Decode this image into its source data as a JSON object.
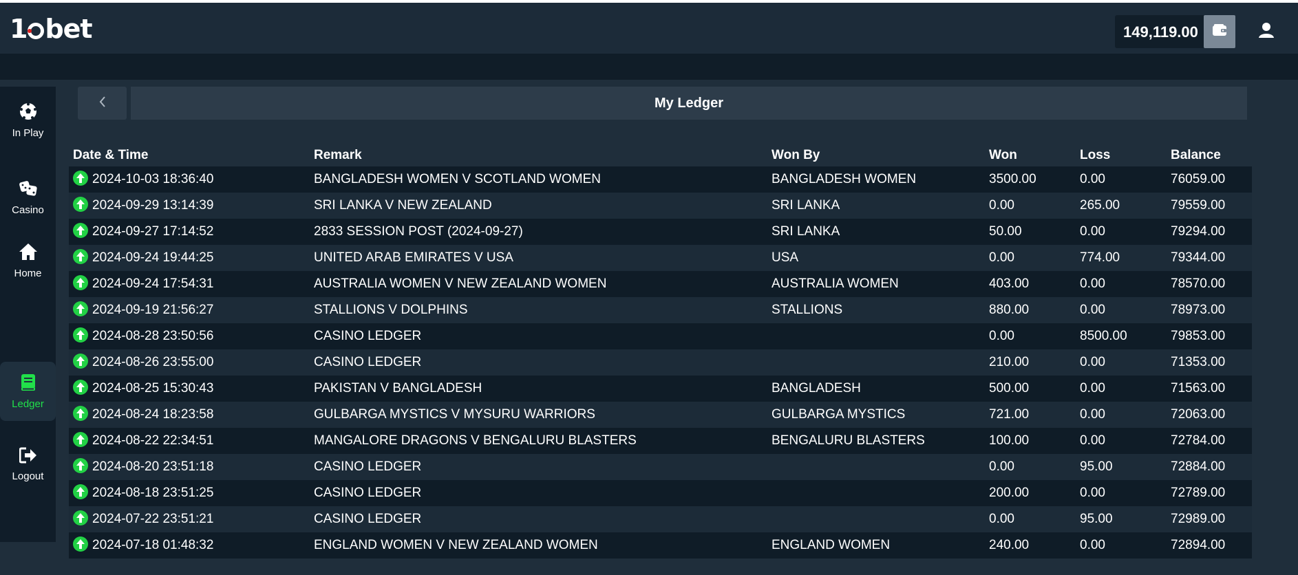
{
  "header": {
    "balance": "149,119.00"
  },
  "sidebar": {
    "items": [
      {
        "label": "In Play",
        "icon": "soccer-ball-icon"
      },
      {
        "label": "Casino",
        "icon": "dice-icon"
      },
      {
        "label": "Home",
        "icon": "home-icon"
      },
      {
        "label": "Ledger",
        "icon": "ledger-book-icon",
        "active": true
      },
      {
        "label": "Logout",
        "icon": "logout-icon"
      }
    ]
  },
  "page": {
    "title": "My Ledger"
  },
  "table": {
    "headers": [
      "Date & Time",
      "Remark",
      "Won By",
      "Won",
      "Loss",
      "Balance"
    ],
    "rows": [
      [
        "2024-10-03 18:36:40",
        "BANGLADESH WOMEN V SCOTLAND WOMEN",
        "BANGLADESH WOMEN",
        "3500.00",
        "0.00",
        "76059.00"
      ],
      [
        "2024-09-29 13:14:39",
        "SRI LANKA V NEW ZEALAND",
        "SRI LANKA",
        "0.00",
        "265.00",
        "79559.00"
      ],
      [
        "2024-09-27 17:14:52",
        "2833 SESSION POST (2024-09-27)",
        "SRI LANKA",
        "50.00",
        "0.00",
        "79294.00"
      ],
      [
        "2024-09-24 19:44:25",
        "UNITED ARAB EMIRATES V USA",
        "USA",
        "0.00",
        "774.00",
        "79344.00"
      ],
      [
        "2024-09-24 17:54:31",
        "AUSTRALIA WOMEN V NEW ZEALAND WOMEN",
        "AUSTRALIA WOMEN",
        "403.00",
        "0.00",
        "78570.00"
      ],
      [
        "2024-09-19 21:56:27",
        "STALLIONS V DOLPHINS",
        "STALLIONS",
        "880.00",
        "0.00",
        "78973.00"
      ],
      [
        "2024-08-28 23:50:56",
        "CASINO LEDGER",
        "",
        "0.00",
        "8500.00",
        "79853.00"
      ],
      [
        "2024-08-26 23:55:00",
        "CASINO LEDGER",
        "",
        "210.00",
        "0.00",
        "71353.00"
      ],
      [
        "2024-08-25 15:30:43",
        "PAKISTAN V BANGLADESH",
        "BANGLADESH",
        "500.00",
        "0.00",
        "71563.00"
      ],
      [
        "2024-08-24 18:23:58",
        "GULBARGA MYSTICS V MYSURU WARRIORS",
        "GULBARGA MYSTICS",
        "721.00",
        "0.00",
        "72063.00"
      ],
      [
        "2024-08-22 22:34:51",
        "MANGALORE DRAGONS V BENGALURU BLASTERS",
        "BENGALURU BLASTERS",
        "100.00",
        "0.00",
        "72784.00"
      ],
      [
        "2024-08-20 23:51:18",
        "CASINO LEDGER",
        "",
        "0.00",
        "95.00",
        "72884.00"
      ],
      [
        "2024-08-18 23:51:25",
        "CASINO LEDGER",
        "",
        "200.00",
        "0.00",
        "72789.00"
      ],
      [
        "2024-07-22 23:51:21",
        "CASINO LEDGER",
        "",
        "0.00",
        "95.00",
        "72989.00"
      ],
      [
        "2024-07-18 01:48:32",
        "ENGLAND WOMEN V NEW ZEALAND WOMEN",
        "ENGLAND WOMEN",
        "240.00",
        "0.00",
        "72894.00"
      ]
    ]
  },
  "colors": {
    "accent_green": "#22d145",
    "header_bg": "#1c2b39",
    "row_dark": "#0f1c27",
    "row_light": "#1c2b38"
  }
}
